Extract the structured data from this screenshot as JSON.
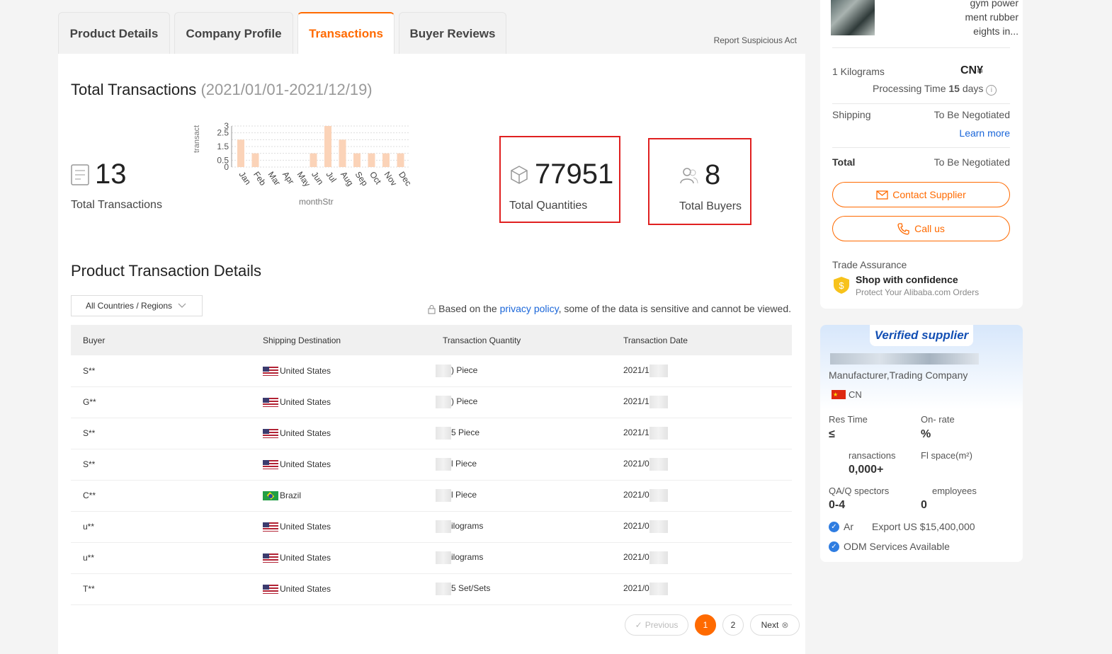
{
  "tabs": [
    "Product Details",
    "Company Profile",
    "Transactions",
    "Buyer Reviews"
  ],
  "report": "Report Suspicious Act",
  "header": {
    "title": "Total Transactions",
    "range": "(2021/01/01-2021/12/19)"
  },
  "stats": {
    "transactions": "13",
    "transactions_label": "Total Transactions",
    "quantities": "77951",
    "quantities_label": "Total Quantities",
    "buyers": "8",
    "buyers_label": "Total Buyers"
  },
  "chart_data": {
    "type": "bar",
    "categories": [
      "Jan",
      "Feb",
      "Mar",
      "Apr",
      "May",
      "Jun",
      "Jul",
      "Aug",
      "Sep",
      "Oct",
      "Nov",
      "Dec"
    ],
    "values": [
      2,
      1,
      0,
      0,
      0,
      1,
      3,
      2,
      1,
      1,
      1,
      1
    ],
    "ylabel": "transact",
    "xlabel": "monthStr",
    "yticks": [
      "0",
      "0.5",
      "1.5",
      "2.5",
      "3"
    ],
    "ylim": [
      0,
      3
    ],
    "color": "#fbd3b8"
  },
  "details": {
    "title": "Product Transaction Details",
    "filter": "All Countries / Regions",
    "privacy_pre": "Based on the",
    "privacy_link": "privacy policy",
    "privacy_post": ", some of the data is sensitive and cannot be viewed."
  },
  "table": {
    "headers": [
      "Buyer",
      "Shipping Destination",
      "Transaction Quantity",
      "Transaction Date"
    ],
    "rows": [
      {
        "buyer": "S**",
        "dest": "United States",
        "flag": "us",
        "qty": ") Piece",
        "date": "2021/1"
      },
      {
        "buyer": "G**",
        "dest": "United States",
        "flag": "us",
        "qty": ") Piece",
        "date": "2021/1"
      },
      {
        "buyer": "S**",
        "dest": "United States",
        "flag": "us",
        "qty": "5 Piece",
        "date": "2021/1"
      },
      {
        "buyer": "S**",
        "dest": "United States",
        "flag": "us",
        "qty": "l Piece",
        "date": "2021/0"
      },
      {
        "buyer": "C**",
        "dest": "Brazil",
        "flag": "br",
        "qty": "l Piece",
        "date": "2021/0"
      },
      {
        "buyer": "u**",
        "dest": "United States",
        "flag": "us",
        "qty": "ilograms",
        "date": "2021/0"
      },
      {
        "buyer": "u**",
        "dest": "United States",
        "flag": "us",
        "qty": "ilograms",
        "date": "2021/0"
      },
      {
        "buyer": "T**",
        "dest": "United States",
        "flag": "us",
        "qty": "5 Set/Sets",
        "date": "2021/0"
      }
    ]
  },
  "pager": {
    "prev": "Previous",
    "pages": [
      "1",
      "2"
    ],
    "next": "Next"
  },
  "side": {
    "product_lines": [
      "gym power",
      "ment rubber",
      "eights in..."
    ],
    "unit": "1 Kilograms",
    "price": "CN¥",
    "processing_label": "Processing Time",
    "processing_value": "15",
    "processing_unit": "days",
    "shipping_label": "Shipping",
    "shipping_value": "To Be Negotiated",
    "learn_more": "Learn more",
    "total_label": "Total",
    "total_value": "To Be Negotiated",
    "contact": "Contact Supplier",
    "call": "Call us",
    "ta_title": "Trade Assurance",
    "ta_main": "Shop with confidence",
    "ta_sub": "Protect Your Alibaba.com Orders"
  },
  "verified": {
    "badge": "Verified supplier",
    "type": "Manufacturer,Trading Company",
    "country": "CN",
    "resp_label": "Res     Time",
    "resp_value": "≤",
    "ontime_label": "On-      rate",
    "ontime_value": "%",
    "trans_label": "ransactions",
    "trans_value": "0,000+",
    "floor_label": "Fl    space(m²)",
    "floor_value": "",
    "qa_label": "QA/Q   spectors",
    "qa_value": "0-4",
    "emp_label": "employees",
    "emp_value": "0",
    "export": "Export US $15,400,000",
    "export_pre": "Ar",
    "odm": "ODM Services Available"
  }
}
